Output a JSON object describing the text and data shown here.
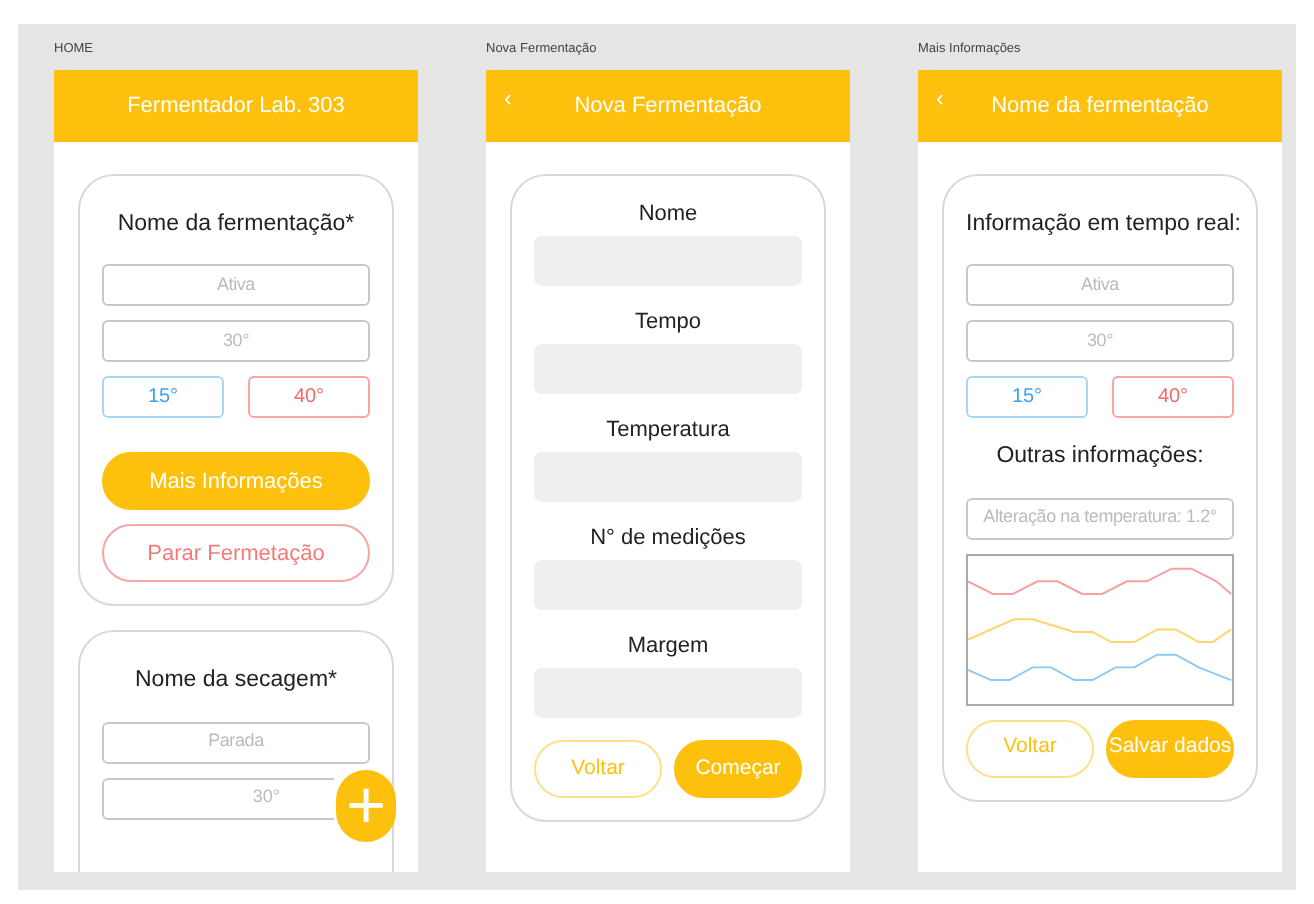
{
  "screens": [
    {
      "label": "HOME",
      "header": {
        "title": "Fermentador Lab. 303"
      },
      "fab": {
        "icon": "+"
      },
      "cards": [
        {
          "items": [
            {
              "kind": "heading",
              "text": "Nome da fermentação*"
            },
            {
              "kind": "readout",
              "text": "Ativa"
            },
            {
              "kind": "readout",
              "text": "30°"
            },
            {
              "kind": "limits",
              "low": "15°",
              "high": "40°"
            },
            {
              "kind": "filled_button",
              "label": "Mais Informações"
            },
            {
              "kind": "danger_button",
              "label": "Parar Fermetação"
            }
          ]
        },
        {
          "items": [
            {
              "kind": "heading",
              "text": "Nome da secagem*"
            },
            {
              "kind": "readout",
              "text": "Parada"
            },
            {
              "kind": "readout",
              "text": "30°"
            }
          ]
        }
      ]
    },
    {
      "label": "Nova Fermentação",
      "header": {
        "title": "Nova Fermentação",
        "back": "‹"
      },
      "cards": [
        {
          "items": [
            {
              "kind": "input",
              "label": "Nome"
            },
            {
              "kind": "input",
              "label": "Tempo"
            },
            {
              "kind": "input",
              "label": "Temperatura"
            },
            {
              "kind": "input",
              "label": "N° de medições"
            },
            {
              "kind": "input",
              "label": "Margem"
            },
            {
              "kind": "buttons",
              "buttons": [
                {
                  "kind": "outline",
                  "label": "Voltar"
                },
                {
                  "kind": "filled",
                  "label": "Começar"
                }
              ]
            }
          ]
        }
      ]
    },
    {
      "label": "Mais Informações",
      "header": {
        "title": "Nome da fermentação",
        "back": "‹"
      },
      "cards": [
        {
          "items": [
            {
              "kind": "heading",
              "text": "Informação em tempo real:"
            },
            {
              "kind": "readout",
              "text": "Ativa"
            },
            {
              "kind": "readout",
              "text": "30°"
            },
            {
              "kind": "limits",
              "low": "15°",
              "high": "40°"
            },
            {
              "kind": "heading",
              "text": "Outras informações:"
            },
            {
              "kind": "readout",
              "text": "Alteração na temperatura: 1.2°"
            },
            {
              "kind": "sparkline"
            },
            {
              "kind": "buttons",
              "buttons": [
                {
                  "kind": "outline",
                  "label": "Voltar"
                },
                {
                  "kind": "filled",
                  "label": "Salvar dados"
                }
              ]
            }
          ]
        }
      ]
    }
  ]
}
